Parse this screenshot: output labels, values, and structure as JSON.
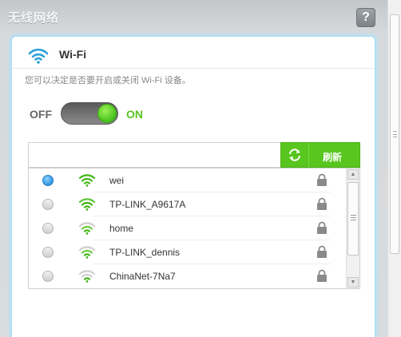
{
  "window": {
    "title": "无线网络",
    "help_label": "?"
  },
  "panel": {
    "title": "Wi-Fi",
    "description": "您可以决定是否要开启或关闭 Wi-Fi 设备。",
    "toggle": {
      "off_label": "OFF",
      "on_label": "ON",
      "state": "on"
    }
  },
  "search": {
    "value": "",
    "placeholder": ""
  },
  "refresh": {
    "label": "刷新"
  },
  "networks": [
    {
      "ssid": "wei",
      "selected": true,
      "locked": true
    },
    {
      "ssid": "TP-LINK_A9617A",
      "selected": false,
      "locked": true
    },
    {
      "ssid": "home",
      "selected": false,
      "locked": true
    },
    {
      "ssid": "TP-LINK_dennis",
      "selected": false,
      "locked": true
    },
    {
      "ssid": "ChinaNet-7Na7",
      "selected": false,
      "locked": true
    }
  ],
  "icons": {
    "title": "wifi-icon",
    "help": "question-icon",
    "refresh": "refresh-icon",
    "signal": "wifi-signal-icon",
    "lock": "lock-icon"
  },
  "colors": {
    "accent_green": "#58c61e",
    "on_text": "#5cc322",
    "selected_radio": "#2e93e0",
    "panel_glow": "#b3e3f7"
  }
}
